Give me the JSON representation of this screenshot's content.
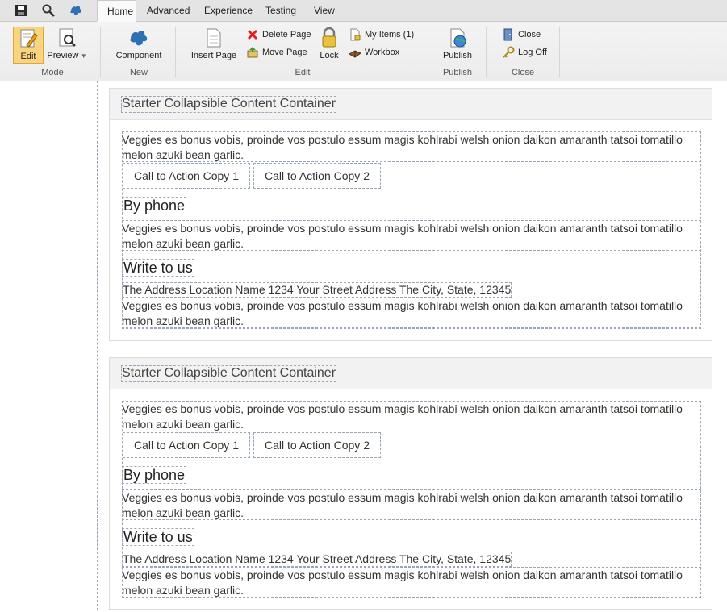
{
  "ribbon": {
    "tabs": [
      {
        "label": "Home",
        "active": true
      },
      {
        "label": "Advanced",
        "active": false
      },
      {
        "label": "Experience",
        "active": false
      },
      {
        "label": "Testing",
        "active": false
      },
      {
        "label": "View",
        "active": false
      }
    ],
    "groups": {
      "mode": {
        "label": "Mode",
        "edit": "Edit",
        "preview": "Preview"
      },
      "new": {
        "label": "New",
        "component": "Component"
      },
      "edit": {
        "label": "Edit",
        "insert_page": "Insert Page",
        "delete_page": "Delete Page",
        "move_page": "Move Page",
        "lock": "Lock",
        "my_items": "My Items (1)",
        "workbox": "Workbox"
      },
      "publish": {
        "label": "Publish",
        "publish": "Publish"
      },
      "close": {
        "label": "Close",
        "close": "Close",
        "log_off": "Log Off"
      }
    }
  },
  "containers": [
    {
      "title": "Starter Collapsible Content Container",
      "intro": "Veggies es bonus vobis, proinde vos postulo essum magis kohlrabi welsh onion daikon amaranth tatsoi tomatillo melon azuki bean garlic.",
      "cta1": "Call to Action Copy 1",
      "cta2": "Call to Action Copy 2",
      "phone_heading": "By phone",
      "phone_text": "Veggies es bonus vobis, proinde vos postulo essum magis kohlrabi welsh onion daikon amaranth tatsoi tomatillo melon azuki bean garlic.",
      "write_heading": "Write to us",
      "address": "The Address Location Name 1234 Your Street Address The City, State, 12345",
      "write_text": "Veggies es bonus vobis, proinde vos postulo essum magis kohlrabi welsh onion daikon amaranth tatsoi tomatillo melon azuki bean garlic."
    },
    {
      "title": "Starter Collapsible Content Container",
      "intro": "Veggies es bonus vobis, proinde vos postulo essum magis kohlrabi welsh onion daikon amaranth tatsoi tomatillo melon azuki bean garlic.",
      "cta1": "Call to Action Copy 1",
      "cta2": "Call to Action Copy 2",
      "phone_heading": "By phone",
      "phone_text": "Veggies es bonus vobis, proinde vos postulo essum magis kohlrabi welsh onion daikon amaranth tatsoi tomatillo melon azuki bean garlic.",
      "write_heading": "Write to us",
      "address": "The Address Location Name 1234 Your Street Address The City, State, 12345",
      "write_text": "Veggies es bonus vobis, proinde vos postulo essum magis kohlrabi welsh onion daikon amaranth tatsoi tomatillo melon azuki bean garlic."
    }
  ],
  "colors": {
    "accent_active": "#fbd57e",
    "dashed_outline": "#9aa6b5",
    "header_bg": "#f2f2f2"
  }
}
